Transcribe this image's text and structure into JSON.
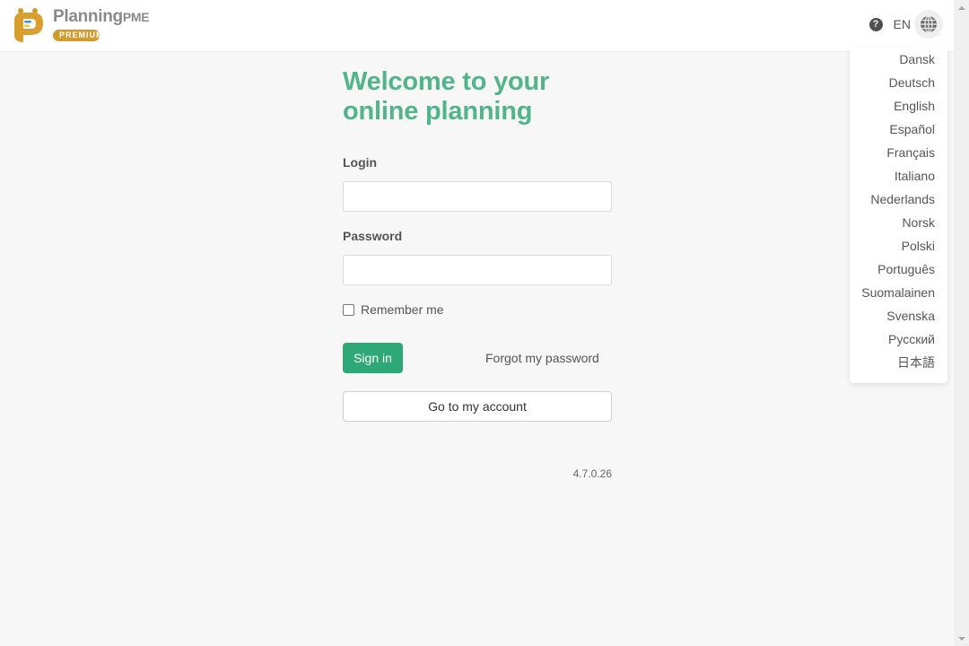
{
  "brand": {
    "name": "Planning",
    "name_suffix": "PME",
    "badge": "PREMIUM",
    "colors": {
      "logo_gold": "#d19a2c",
      "logo_blue": "#3b8fd6",
      "logo_yellow": "#f2c230",
      "name_gray": "#8a8a8a"
    }
  },
  "header": {
    "help_icon": "question-circle-icon",
    "language_code": "EN",
    "globe_icon": "globe-icon"
  },
  "language_menu": {
    "items": [
      {
        "label": "Dansk"
      },
      {
        "label": "Deutsch"
      },
      {
        "label": "English"
      },
      {
        "label": "Español"
      },
      {
        "label": "Français"
      },
      {
        "label": "Italiano"
      },
      {
        "label": "Nederlands"
      },
      {
        "label": "Norsk"
      },
      {
        "label": "Polski"
      },
      {
        "label": "Português"
      },
      {
        "label": "Suomalainen"
      },
      {
        "label": "Svenska"
      },
      {
        "label": "Русский"
      },
      {
        "label": "日本語"
      }
    ]
  },
  "form": {
    "title_line1": "Welcome to your",
    "title_line2": "online planning",
    "login_label": "Login",
    "login_value": "",
    "password_label": "Password",
    "password_value": "",
    "remember_label": "Remember me",
    "remember_checked": false,
    "signin_label": "Sign in",
    "forgot_label": "Forgot my password",
    "account_label": "Go to my account",
    "version": "4.7.0.26"
  },
  "colors": {
    "accent_green": "#2ea876",
    "title_green": "#52b48b",
    "background": "#f7f7f7"
  }
}
